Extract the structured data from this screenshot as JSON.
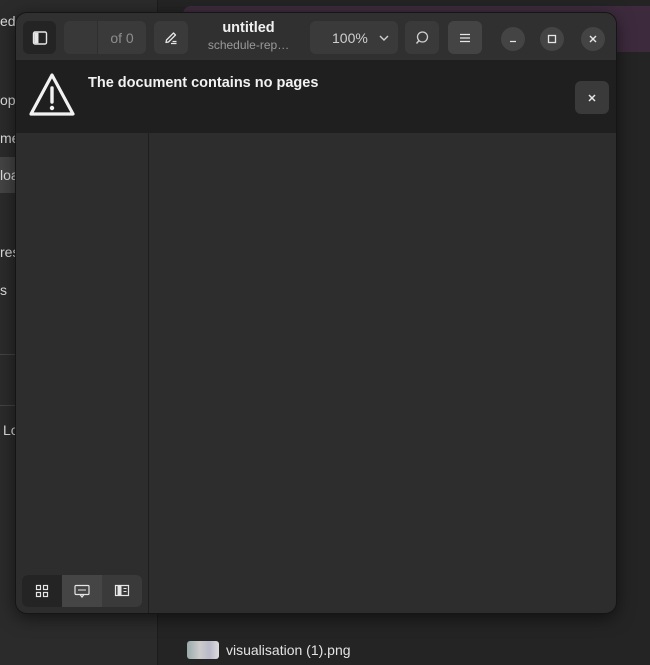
{
  "background": {
    "sidebar_items": [
      "ed",
      "op",
      "me",
      "loa",
      "res",
      "s",
      "Lo"
    ],
    "file_label": "visualisation (1).png"
  },
  "header": {
    "title": "untitled",
    "subtitle": "schedule-rep…",
    "page_total": "of 0",
    "zoom": "100%"
  },
  "infobar": {
    "message": "The document contains no pages"
  },
  "sidebar": {
    "modes": [
      "thumbnails",
      "annotations",
      "bookmarks"
    ]
  },
  "icons": {
    "sidebar_toggle": "sidebar-icon",
    "annotate": "pencil-icon",
    "search": "search-icon",
    "menu": "hamburger-icon",
    "minimize": "minimize-icon",
    "maximize": "maximize-icon",
    "close": "close-icon",
    "warning": "warning-icon"
  }
}
